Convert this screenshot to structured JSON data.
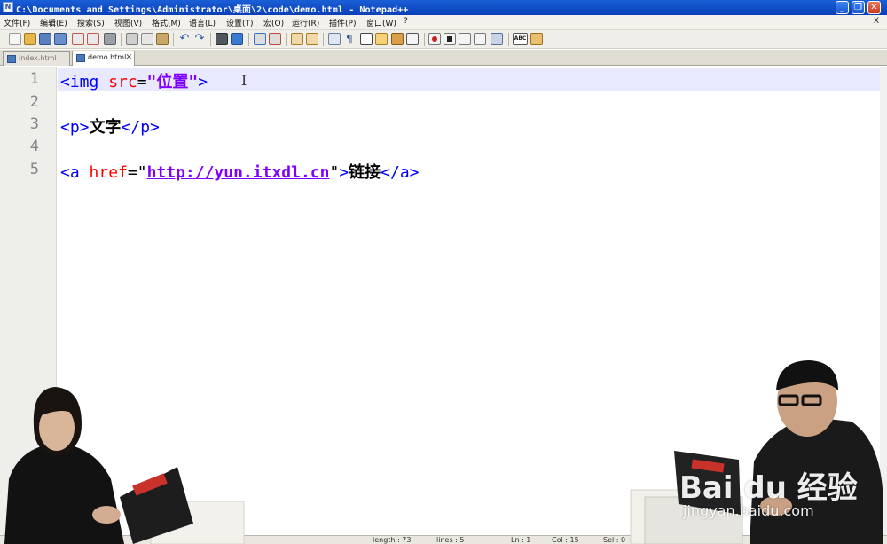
{
  "window": {
    "title": "C:\\Documents and Settings\\Administrator\\桌面\\2\\code\\demo.html - Notepad++",
    "icon": "notepadpp-icon",
    "controls": {
      "minimize": "_",
      "restore": "❐",
      "close": "✕"
    }
  },
  "menu": {
    "items": [
      "文件(F)",
      "编辑(E)",
      "搜索(S)",
      "视图(V)",
      "格式(M)",
      "语言(L)",
      "设置(T)",
      "宏(O)",
      "运行(R)",
      "插件(P)",
      "窗口(W)",
      "?"
    ],
    "close": "X"
  },
  "toolbar": {
    "icons": [
      "new-file-icon",
      "open-file-icon",
      "save-icon",
      "save-all-icon",
      "close-icon",
      "close-all-icon",
      "print-icon",
      "cut-icon",
      "copy-icon",
      "paste-icon",
      "undo-icon",
      "redo-icon",
      "find-icon",
      "replace-icon",
      "zoom-in-icon",
      "zoom-out-icon",
      "sync-vertical-icon",
      "sync-horizontal-icon",
      "word-wrap-icon",
      "show-all-chars-icon",
      "indent-guide-icon",
      "user-lang-icon",
      "doc-map-icon",
      "function-list-icon",
      "macro-record-icon",
      "macro-stop-icon",
      "macro-play-icon",
      "macro-run-multiple-icon",
      "macro-save-icon",
      "spellcheck-icon",
      "spellcheck-settings-icon"
    ]
  },
  "tabs": [
    {
      "label": "index.html",
      "active": false
    },
    {
      "label": "demo.html",
      "active": true
    }
  ],
  "editor": {
    "line_numbers": [
      "1",
      "2",
      "3",
      "4",
      "5"
    ],
    "current_line": 1,
    "lines": {
      "l1": {
        "open": "<img ",
        "attr": "src",
        "eq": "=",
        "value": "\"位置\"",
        "close": ">"
      },
      "l3": {
        "open": "<p>",
        "text": "文字",
        "close": "</p>"
      },
      "l5": {
        "open": "<a ",
        "attr": "href",
        "eq": "=\"",
        "url": "http://yun.itxdl.cn",
        "q": "\"",
        "gt": ">",
        "text": "链接",
        "close": "</a>"
      }
    }
  },
  "statusbar": {
    "length": "length : 73",
    "lines": "lines : 5",
    "ln": "Ln : 1",
    "col": "Col : 15",
    "sel": "Sel : 0"
  },
  "watermark": {
    "brand": "Bai du 经验",
    "site": "jingyan.baidu.com"
  },
  "colors": {
    "tag": "#0000ff",
    "attribute": "#ff0000",
    "string": "#8000ff",
    "current_line_bg": "#e8e8ff",
    "title_bar": "#1a5fd6"
  }
}
